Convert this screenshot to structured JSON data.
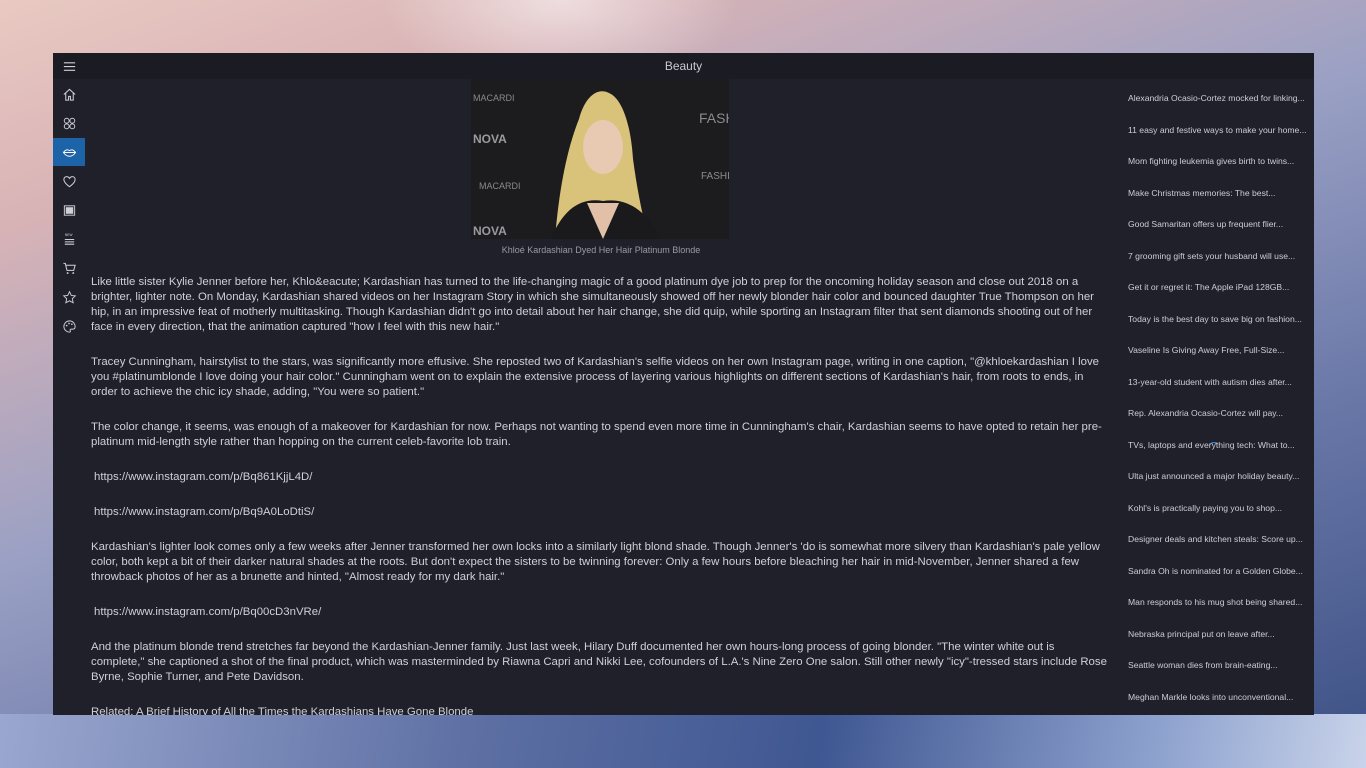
{
  "window": {
    "title": "Beauty"
  },
  "nav": [
    {
      "name": "menu-icon"
    },
    {
      "name": "home-icon"
    },
    {
      "name": "apps-icon"
    },
    {
      "name": "lips-icon",
      "active": true
    },
    {
      "name": "heart-icon"
    },
    {
      "name": "book-icon"
    },
    {
      "name": "new-list-icon",
      "badge": "NEW"
    },
    {
      "name": "cart-icon"
    },
    {
      "name": "star-icon"
    },
    {
      "name": "palette-icon"
    }
  ],
  "article": {
    "photo_text": [
      "FASHION",
      "NOVA",
      "MACARDI",
      "FASHI"
    ],
    "caption": "Khloé Kardashian Dyed Her Hair Platinum Blonde",
    "paragraphs": [
      "Like little sister Kylie Jenner before her, Khlo&eacute; Kardashian has turned to the life-changing magic of a good platinum dye job to prep for the oncoming holiday season and close out 2018 on a brighter, lighter note. On Monday, Kardashian shared videos on her Instagram Story in which she simultaneously showed off her newly blonder hair color and bounced daughter True Thompson on her hip, in an impressive feat of motherly multitasking. Though Kardashian didn't go into detail about her hair change, she did quip, while sporting an Instagram filter that sent diamonds shooting out of her face in every direction, that the animation captured \"how I feel with this new hair.\"",
      "Tracey Cunningham, hairstylist to the stars, was significantly more effusive. She reposted two of Kardashian's selfie videos on her own Instagram page, writing in one caption, \"@khloekardashian I love you #platinumblonde I love doing your hair color.\" Cunningham went on to explain the extensive process of layering various highlights on different sections of Kardashian's hair, from roots to ends, in order to achieve the chic icy shade, adding, \"You were so patient.\"",
      "The color change, it seems, was enough of a makeover for Kardashian for now. Perhaps not wanting to spend even more time in Cunningham's chair, Kardashian seems to have opted to retain her pre-platinum mid-length style rather than hopping on the current celeb-favorite lob train.",
      "https://www.instagram.com/p/Bq861KjjL4D/",
      "https://www.instagram.com/p/Bq9A0LoDtiS/",
      "Kardashian's lighter look comes only a few weeks after Jenner transformed her own locks into a similarly light blond shade. Though Jenner's 'do is somewhat more silvery than Kardashian's pale yellow color, both kept a bit of their darker natural shades at the roots. But don't expect the sisters to be twinning forever: Only a few hours before bleaching her hair in mid-November, Jenner shared a few throwback photos of her as a brunette and hinted, \"Almost ready for my dark hair.\"",
      "https://www.instagram.com/p/Bq00cD3nVRe/",
      "And the platinum blonde trend stretches far beyond the Kardashian-Jenner family. Just last week, Hilary Duff documented her own hours-long process of going blonder. \"The winter white out is complete,\" she captioned a shot of the final product, which was masterminded by Riawna Capri and Nikki Lee, cofounders of L.A.'s Nine Zero One salon. Still other newly \"icy\"-tressed stars include Rose Byrne, Sophie Turner, and Pete Davidson.",
      "Related: A Brief History of All the Times the Kardashians Have Gone Blonde"
    ]
  },
  "sidebar": {
    "items": [
      "Alexandria Ocasio-Cortez mocked for linking...",
      "11 easy and festive ways to make your home...",
      "Mom fighting leukemia gives birth to twins...",
      "Make Christmas memories: The best...",
      "Good Samaritan offers up frequent flier...",
      "7 grooming gift sets your husband will use...",
      "Get it or regret it: The Apple iPad 128GB...",
      "Today is the best day to save big on fashion...",
      "Vaseline Is Giving Away Free, Full-Size...",
      "13-year-old student with autism dies after...",
      "Rep. Alexandria Ocasio-Cortez will pay...",
      "TVs, laptops and everything tech: What to...",
      "Ulta just announced a major holiday beauty...",
      "Kohl's is practically paying you to shop...",
      "Designer deals and kitchen steals: Score up...",
      "Sandra Oh is nominated for a Golden Globe...",
      "Man responds to his mug shot being shared...",
      "Nebraska principal put on leave after...",
      "Seattle woman dies from brain-eating...",
      "Meghan Markle looks into unconventional..."
    ]
  },
  "colors": {
    "accent": "#1d63a8",
    "window_bg": "#20202b",
    "titlebar_bg": "#1b1b24"
  }
}
